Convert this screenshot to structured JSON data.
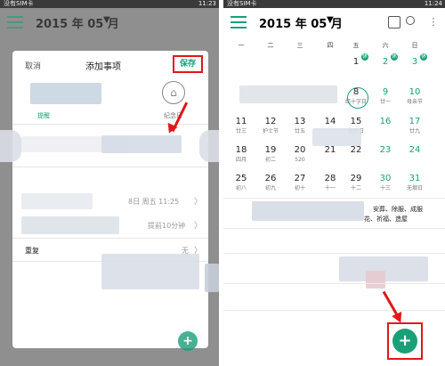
{
  "status_left": {
    "carrier": "没有SIM卡",
    "time": "11:23"
  },
  "status_right": {
    "carrier": "没有SIM卡",
    "time": "11:24"
  },
  "header": {
    "month": "2015 年 05 月",
    "drop": "▼"
  },
  "dialog": {
    "cancel": "取消",
    "title": "添加事项",
    "save": "保存",
    "tabs": [
      "提醒",
      "纪念日"
    ],
    "start_time": "8日 周五 11:25",
    "reminder": "提前10分钟",
    "repeat_label": "重复",
    "repeat_value": "无"
  },
  "weekdays": [
    "一",
    "二",
    "三",
    "四",
    "五",
    "六",
    "日"
  ],
  "calendar": [
    [
      {
        "d": "",
        "l": ""
      },
      {
        "d": "",
        "l": ""
      },
      {
        "d": "",
        "l": ""
      },
      {
        "d": "",
        "l": ""
      },
      {
        "d": "1",
        "l": "",
        "badge": "休"
      },
      {
        "d": "2",
        "l": "",
        "badge": "休"
      },
      {
        "d": "3",
        "l": "",
        "badge": "休"
      }
    ],
    [
      {
        "d": "",
        "l": ""
      },
      {
        "d": "",
        "l": ""
      },
      {
        "d": "",
        "l": ""
      },
      {
        "d": "",
        "l": ""
      },
      {
        "d": "8",
        "l": "红十字日"
      },
      {
        "d": "9",
        "l": "廿一"
      },
      {
        "d": "10",
        "l": "母亲节"
      }
    ],
    [
      {
        "d": "11",
        "l": "廿三"
      },
      {
        "d": "12",
        "l": "护士节"
      },
      {
        "d": "13",
        "l": "廿五"
      },
      {
        "d": "14",
        "l": ""
      },
      {
        "d": "15",
        "l": "家庭日"
      },
      {
        "d": "16",
        "l": ""
      },
      {
        "d": "17",
        "l": "廿九"
      }
    ],
    [
      {
        "d": "18",
        "l": "四月"
      },
      {
        "d": "19",
        "l": "初二"
      },
      {
        "d": "20",
        "l": "520"
      },
      {
        "d": "21",
        "l": ""
      },
      {
        "d": "22",
        "l": ""
      },
      {
        "d": "23",
        "l": ""
      },
      {
        "d": "24",
        "l": ""
      }
    ],
    [
      {
        "d": "25",
        "l": "初八"
      },
      {
        "d": "26",
        "l": "初九"
      },
      {
        "d": "27",
        "l": "初十"
      },
      {
        "d": "28",
        "l": "十一"
      },
      {
        "d": "29",
        "l": "十二"
      },
      {
        "d": "30",
        "l": "十三"
      },
      {
        "d": "31",
        "l": "无烟日"
      }
    ]
  ],
  "almanac": {
    "line1": "安葬、除服、成服",
    "line2": "花、祈福、造屋"
  },
  "fab": {
    "label": "+"
  },
  "colors": {
    "accent": "#19a079",
    "annotation": "#e01818"
  }
}
